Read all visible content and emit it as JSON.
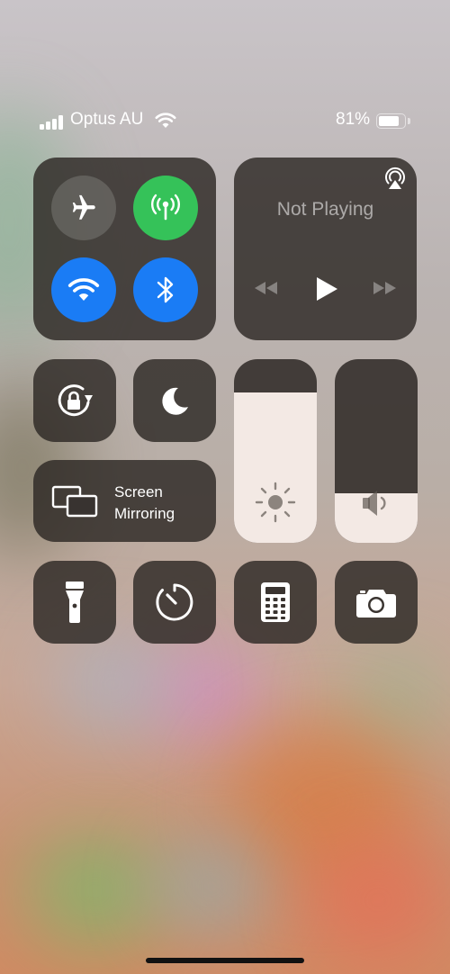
{
  "status_bar": {
    "carrier": "Optus AU",
    "battery_percent": "81%",
    "battery_level": 0.81,
    "signal_bars": 4
  },
  "connectivity": {
    "airplane_mode": {
      "icon": "airplane-icon",
      "on": false
    },
    "cellular_data": {
      "icon": "antenna-icon",
      "on": true,
      "color": "#35c259"
    },
    "wifi": {
      "icon": "wifi-icon",
      "on": true,
      "color": "#1a7cf5"
    },
    "bluetooth": {
      "icon": "bluetooth-icon",
      "on": true,
      "color": "#1a7cf5"
    }
  },
  "media": {
    "status": "Not Playing",
    "airplay_icon": "airplay-icon",
    "controls": [
      "rewind-icon",
      "play-icon",
      "fast-forward-icon"
    ]
  },
  "toggles": {
    "rotation_lock": {
      "icon": "rotation-lock-icon"
    },
    "do_not_disturb": {
      "icon": "moon-icon"
    }
  },
  "screen_mirroring": {
    "label_line1": "Screen",
    "label_line2": "Mirroring",
    "icon": "screen-mirroring-icon"
  },
  "sliders": {
    "brightness_level": 0.82,
    "volume_level": 0.27
  },
  "shortcuts": [
    {
      "name": "flashlight",
      "icon": "flashlight-icon"
    },
    {
      "name": "timer",
      "icon": "timer-icon"
    },
    {
      "name": "calculator",
      "icon": "calculator-icon"
    },
    {
      "name": "camera",
      "icon": "camera-icon"
    }
  ],
  "colors": {
    "module_bg": "#2d2825",
    "green": "#35c259",
    "blue": "#1a7cf5",
    "slider_fill": "#f3e9e4"
  }
}
